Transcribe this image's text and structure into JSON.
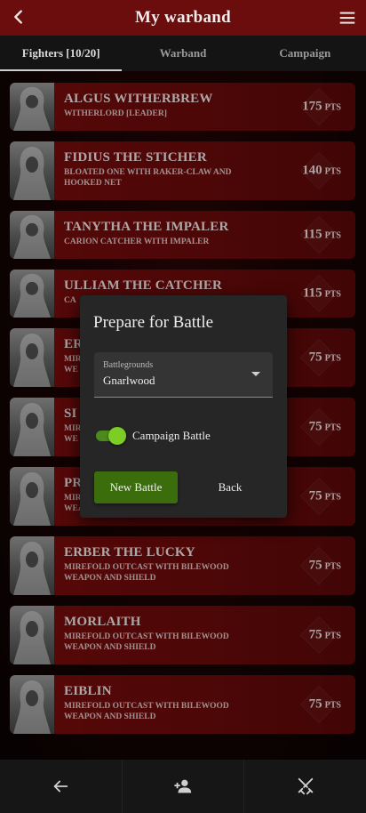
{
  "appbar": {
    "title": "My warband",
    "back_icon": "arrow-left-icon",
    "menu_icon": "hamburger-menu-icon"
  },
  "tabs": [
    {
      "label": "Fighters [10/20]",
      "active": true
    },
    {
      "label": "Warband",
      "active": false
    },
    {
      "label": "Campaign",
      "active": false
    }
  ],
  "points_unit": "PTS",
  "fighters": [
    {
      "name": "ALGUS WITHERBREW",
      "subtitle": "WITHERLORD [LEADER]",
      "points": "175"
    },
    {
      "name": "FIDIUS THE STICHER",
      "subtitle": "BLOATED ONE WITH RAKER-CLAW AND HOOKED NET",
      "points": "140"
    },
    {
      "name": "TANYTHA THE IMPALER",
      "subtitle": "CARION CATCHER WITH IMPALER",
      "points": "115"
    },
    {
      "name": "ULLIAM THE CATCHER",
      "subtitle": "CA",
      "points": "115"
    },
    {
      "name": "ER",
      "subtitle": "MIR\nWE",
      "points": "75"
    },
    {
      "name": "SI",
      "subtitle": "MIR\nWE",
      "points": "75"
    },
    {
      "name": "PR",
      "subtitle": "MIR\nWEA",
      "points": "75"
    },
    {
      "name": "ERBER THE LUCKY",
      "subtitle": "MIREFOLD OUTCAST WITH BILEWOOD WEAPON AND SHIELD",
      "points": "75"
    },
    {
      "name": "MORLAITH",
      "subtitle": "MIREFOLD OUTCAST WITH BILEWOOD WEAPON AND SHIELD",
      "points": "75"
    },
    {
      "name": "EIBLIN",
      "subtitle": "MIREFOLD OUTCAST WITH BILEWOOD WEAPON AND SHIELD",
      "points": "75"
    }
  ],
  "dialog": {
    "title": "Prepare for Battle",
    "select_label": "Battlegrounds",
    "select_value": "Gnarlwood",
    "toggle_label": "Campaign Battle",
    "toggle_on": true,
    "primary_button": "New Battle",
    "secondary_button": "Back"
  },
  "bottom_nav": [
    {
      "icon": "arrow-left-icon"
    },
    {
      "icon": "add-person-icon"
    },
    {
      "icon": "crossed-swords-icon"
    }
  ],
  "colors": {
    "appbar": "#6b0d0d",
    "card": "#7a0d0d",
    "toggle_on": "#7ccd24",
    "primary_button": "#3c6d0d"
  }
}
